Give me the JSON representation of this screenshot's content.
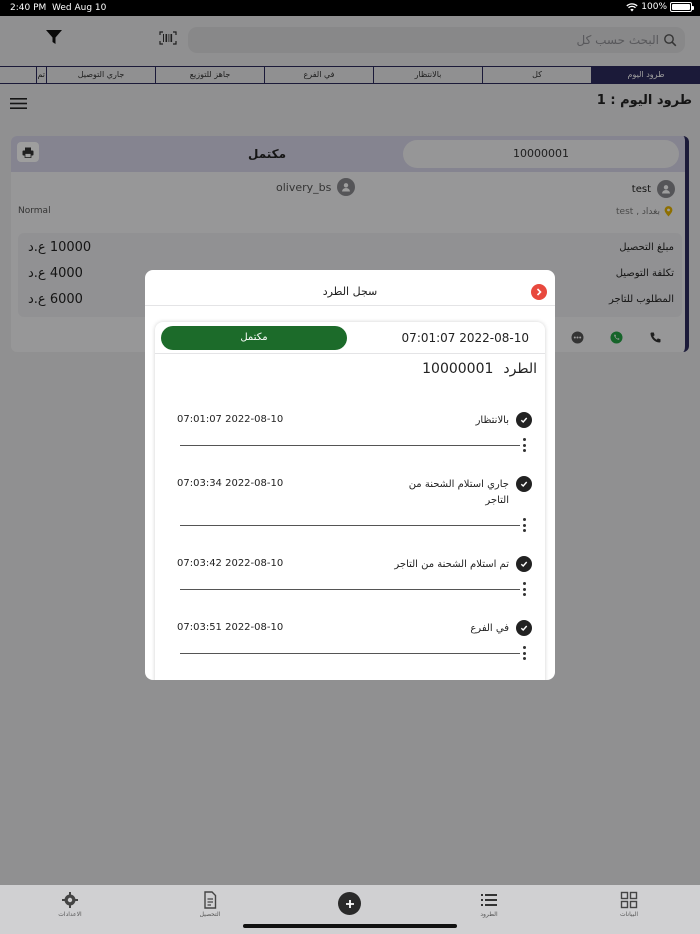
{
  "status_bar": {
    "time": "2:40 PM",
    "date": "Wed Aug 10",
    "battery": "100%"
  },
  "search": {
    "placeholder": "البحث حسب كل"
  },
  "tabs": [
    {
      "label": "طرود اليوم",
      "active": true
    },
    {
      "label": "كل"
    },
    {
      "label": "بالانتظار"
    },
    {
      "label": "في الفرع"
    },
    {
      "label": "جاهز للتوزيع"
    },
    {
      "label": "جاري التوصيل"
    },
    {
      "label": "تم"
    }
  ],
  "page_title": "طرود اليوم : 1",
  "card": {
    "status": "مكتمل",
    "parcel_id": "10000001",
    "receiver_name": "test",
    "sender_name": "olivery_bs",
    "location": "بغداد , test",
    "priority": "Normal",
    "amounts": [
      {
        "label": "مبلغ التحصيل",
        "value": "10000 ع.د"
      },
      {
        "label": "تكلفة التوصيل",
        "value": "4000 ع.د"
      },
      {
        "label": "المطلوب للتاجر",
        "value": "6000 ع.د"
      }
    ]
  },
  "modal": {
    "title": "سجل الطرد",
    "status": "مكتمل",
    "status_color": "#1c6b2a",
    "date": "07:01:07 2022-08-10",
    "parcel_label": "الطرد",
    "parcel_id": "10000001",
    "history": [
      {
        "status": "بالانتظار",
        "time": "07:01:07 2022-08-10"
      },
      {
        "status": "جاري استلام الشحنة من التاجر",
        "time": "07:03:34 2022-08-10"
      },
      {
        "status": "تم استلام الشحنة من التاجر",
        "time": "07:03:42 2022-08-10"
      },
      {
        "status": "في الفرع",
        "time": "07:03:51 2022-08-10"
      }
    ]
  },
  "bottom_nav": [
    {
      "label": "الاعدادات",
      "icon": "gear-icon"
    },
    {
      "label": "التحصيل",
      "icon": "document-icon"
    },
    {
      "label": "الطرود",
      "icon": "list-icon"
    },
    {
      "label": "البيانات",
      "icon": "grid-icon"
    }
  ],
  "colors": {
    "primary": "#2d2a5c",
    "success": "#1c6b2a",
    "close": "#e8493e",
    "whatsapp": "#25a244"
  }
}
